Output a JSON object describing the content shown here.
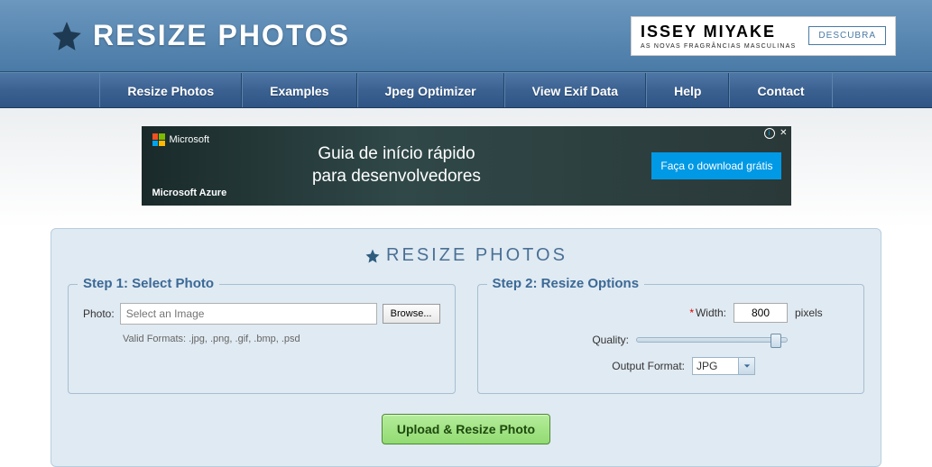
{
  "header": {
    "logo_text": "RESIZE PHOTOS",
    "ad": {
      "brand": "ISSEY MIYAKE",
      "tagline": "AS NOVAS FRAGRÂNCIAS MASCULINAS",
      "cta": "DESCUBRA"
    }
  },
  "nav": {
    "items": [
      "Resize Photos",
      "Examples",
      "Jpeg Optimizer",
      "View Exif Data",
      "Help",
      "Contact"
    ]
  },
  "banner": {
    "ms_label": "Microsoft",
    "azure_label": "Microsoft Azure",
    "line1": "Guia de início rápido",
    "line2": "para desenvolvedores",
    "cta": "Faça o download grátis"
  },
  "panel": {
    "title": "RESIZE PHOTOS",
    "step1": {
      "legend": "Step 1: Select Photo",
      "photo_label": "Photo:",
      "placeholder": "Select an Image",
      "browse": "Browse...",
      "valid_formats": "Valid Formats: .jpg, .png, .gif, .bmp, .psd"
    },
    "step2": {
      "legend": "Step 2: Resize Options",
      "width_label": "Width:",
      "width_value": "800",
      "width_suffix": "pixels",
      "quality_label": "Quality:",
      "format_label": "Output Format:",
      "format_value": "JPG"
    },
    "upload": "Upload & Resize Photo"
  }
}
